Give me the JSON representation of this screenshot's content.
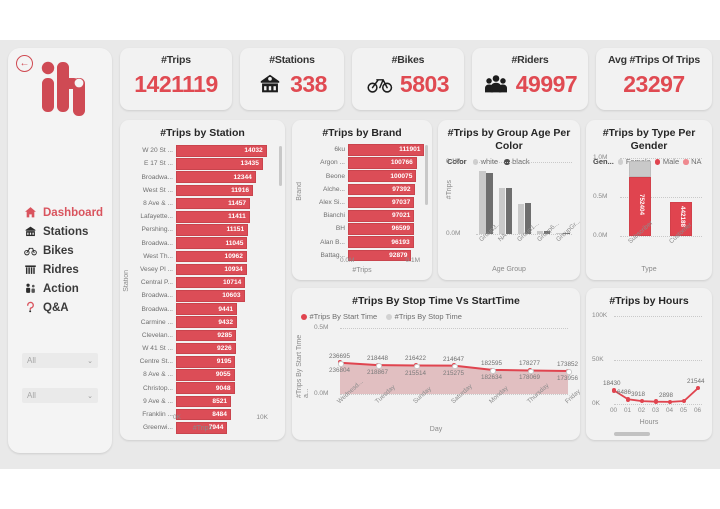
{
  "app": {
    "back_label": "back",
    "logo_name": "iti-logo"
  },
  "sidebar": {
    "items": [
      {
        "label": "Dashboard",
        "icon": "home-icon",
        "active": true
      },
      {
        "label": "Stations",
        "icon": "station-icon",
        "active": false
      },
      {
        "label": "Bikes",
        "icon": "bike-icon",
        "active": false
      },
      {
        "label": "Ridres",
        "icon": "riders-icon",
        "active": false
      },
      {
        "label": "Action",
        "icon": "action-icon",
        "active": false
      },
      {
        "label": "Q&A",
        "icon": "question-icon",
        "active": false
      }
    ],
    "slicers": [
      {
        "value": "All",
        "icon": "chevron-down-icon"
      },
      {
        "value": "All",
        "icon": "chevron-down-icon"
      }
    ]
  },
  "kpis": [
    {
      "label": "#Trips",
      "value": "1421119",
      "icon": null
    },
    {
      "label": "#Stations",
      "value": "338",
      "icon": "station-icon"
    },
    {
      "label": "#Bikes",
      "value": "5803",
      "icon": "bike-icon"
    },
    {
      "label": "#Riders",
      "value": "49997",
      "icon": "riders-icon"
    },
    {
      "label": "Avg #Trips Of Trips",
      "value": "23297",
      "icon": null
    }
  ],
  "colors": {
    "accent": "#e04a52",
    "bar": "#dc4d57",
    "page_bg": "#e9e9e9",
    "card_bg": "#f2f2f2",
    "gray_light": "#c9c9c9",
    "gray_dark": "#6e6e6e"
  },
  "chart_data": [
    {
      "id": "trips-by-station",
      "type": "bar",
      "orientation": "horizontal",
      "title": "#Trips by Station",
      "xlabel": "#Trips",
      "ylabel": "Station",
      "xlim": [
        0,
        15000
      ],
      "xticks": [
        "0K",
        "10K"
      ],
      "grid": false,
      "categories": [
        "W 20 St ...",
        "E 17 St ...",
        "Broadwa...",
        "West St ...",
        "8 Ave & ...",
        "Lafayette...",
        "Pershing...",
        "Broadwa...",
        "West Th...",
        "Vesey Pl ...",
        "Central P...",
        "Broadwa...",
        "Broadwa...",
        "Carmine ...",
        "Clevelan...",
        "W 41 St ...",
        "Centre St...",
        "8 Ave & ...",
        "Christop...",
        "9 Ave & ...",
        "Franklin ...",
        "Greenwi..."
      ],
      "values": [
        14032,
        13435,
        12344,
        11916,
        11457,
        11411,
        11151,
        11045,
        10962,
        10934,
        10714,
        10603,
        9441,
        9432,
        9285,
        9226,
        9195,
        9055,
        9048,
        8521,
        8484,
        7944
      ]
    },
    {
      "id": "trips-by-brand",
      "type": "bar",
      "orientation": "horizontal",
      "title": "#Trips by Brand",
      "xlabel": "#Trips",
      "ylabel": "Brand",
      "xlim": [
        0,
        120000
      ],
      "xticks": [
        "0.0M",
        "0.1M"
      ],
      "grid": false,
      "categories": [
        "6ku",
        "Argon ...",
        "Beone",
        "Alche...",
        "Alex Si...",
        "Bianchi",
        "BH",
        "Alan B...",
        "Battag..."
      ],
      "values": [
        111901,
        100766,
        100075,
        97392,
        97037,
        97021,
        96599,
        96193,
        92879
      ]
    },
    {
      "id": "trips-by-group-age-per-color",
      "type": "bar",
      "orientation": "vertical",
      "grouped": true,
      "title": "#Trips by Group Age Per Color",
      "xlabel": "Age Group",
      "ylabel": "#Trips",
      "ylim": [
        0,
        130000
      ],
      "yticks": [
        "0.0M",
        "0.1M"
      ],
      "grid": true,
      "legend_title": "Color",
      "legend_position": "top",
      "categories": [
        "Group3...",
        "NA",
        "Group1...",
        "Group6...",
        "GroupGr..."
      ],
      "series": [
        {
          "name": "white",
          "color": "#c9c9c9",
          "values": [
            113000,
            83000,
            55000,
            5500,
            1200
          ]
        },
        {
          "name": "black",
          "color": "#6e6e6e",
          "values": [
            110000,
            83000,
            56000,
            5000,
            1000
          ]
        }
      ]
    },
    {
      "id": "trips-by-type-per-gender",
      "type": "bar",
      "orientation": "vertical",
      "stacked": true,
      "title": "#Trips by Type Per Gender",
      "xlabel": "Type",
      "ylabel": "",
      "ylim": [
        0,
        1000000
      ],
      "yticks": [
        "0.0M",
        "0.5M",
        "1.0M"
      ],
      "grid": true,
      "legend_title": "Gen...",
      "legend_position": "top",
      "categories": [
        "Subscriber",
        "Customer"
      ],
      "series": [
        {
          "name": "Male",
          "color": "#e0444f",
          "values": [
            752404,
            442188
          ],
          "labels": [
            "752404",
            "442188"
          ]
        },
        {
          "name": "Female",
          "color": "#c9c9c9",
          "values": [
            210000,
            0
          ],
          "labels": [
            "",
            ""
          ]
        },
        {
          "name": "NA",
          "color": "#ef8a90",
          "values": [
            0,
            0
          ],
          "labels": [
            "",
            ""
          ]
        }
      ]
    },
    {
      "id": "trips-by-stop-time-vs-start-time",
      "type": "line",
      "title": "#Trips By Stop Time Vs StartTime",
      "xlabel": "Day",
      "ylabel": "#Trips By Start Time a...",
      "ylim": [
        0,
        500000
      ],
      "yticks": [
        "0.0M",
        "0.5M"
      ],
      "grid": true,
      "legend_position": "top",
      "x": [
        "Wednesd...",
        "Tuesday",
        "Sunday",
        "Saturday",
        "Monday",
        "Thursday",
        "Friday"
      ],
      "series": [
        {
          "name": "#Trips By Start Time",
          "color": "#e0444f",
          "values": [
            236804,
            218867,
            215514,
            215275,
            182634,
            178069,
            173956
          ]
        },
        {
          "name": "#Trips By Stop Time",
          "color": "#c9c9c9",
          "values": [
            236695,
            218448,
            216422,
            214647,
            182595,
            178277,
            173852
          ]
        }
      ]
    },
    {
      "id": "trips-by-hours",
      "type": "line",
      "title": "#Trips by Hours",
      "xlabel": "Hours",
      "ylabel": "",
      "ylim": [
        0,
        120000
      ],
      "yticks": [
        "0K",
        "50K",
        "100K"
      ],
      "grid": true,
      "x": [
        "00",
        "01",
        "02",
        "03",
        "04",
        "05",
        "06"
      ],
      "series": [
        {
          "name": "#Trips",
          "color": "#e0444f",
          "values": [
            18430,
            6486,
            3918,
            3126,
            2898,
            4100,
            21544
          ],
          "labels": [
            "18430",
            "6486",
            "3918",
            "",
            "2898",
            "",
            "21544"
          ]
        }
      ]
    }
  ]
}
